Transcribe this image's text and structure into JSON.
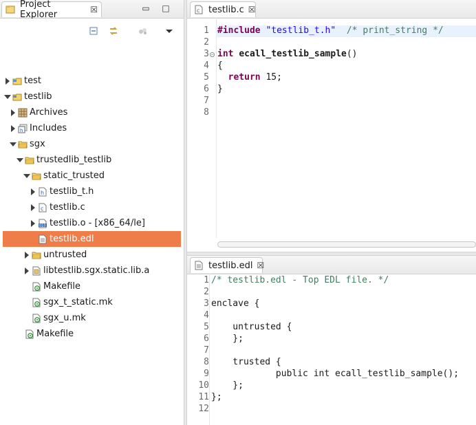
{
  "explorer": {
    "tab_label": "Project Explorer",
    "tab_close": "☒",
    "minimize": "▭",
    "maximize": "□",
    "toolbar_icons": [
      "collapse-all-icon",
      "link-editor-icon",
      "filter-icon",
      "view-menu-icon"
    ],
    "tree": [
      {
        "label": "test",
        "level": 0,
        "twisty": "collapsed",
        "icon": "project-icon"
      },
      {
        "label": "testlib",
        "level": 0,
        "twisty": "expanded",
        "icon": "project-icon"
      },
      {
        "label": "Archives",
        "level": 1,
        "twisty": "collapsed",
        "icon": "archives-icon"
      },
      {
        "label": "Includes",
        "level": 1,
        "twisty": "collapsed",
        "icon": "includes-icon"
      },
      {
        "label": "sgx",
        "level": 1,
        "twisty": "expanded",
        "icon": "folder-icon"
      },
      {
        "label": "trustedlib_testlib",
        "level": 2,
        "twisty": "expanded",
        "icon": "folder-icon"
      },
      {
        "label": "static_trusted",
        "level": 3,
        "twisty": "expanded",
        "icon": "folder-icon"
      },
      {
        "label": "testlib_t.h",
        "level": 4,
        "twisty": "collapsed",
        "icon": "header-file-icon"
      },
      {
        "label": "testlib.c",
        "level": 4,
        "twisty": "collapsed",
        "icon": "c-file-icon"
      },
      {
        "label": "testlib.o - [x86_64/le]",
        "level": 4,
        "twisty": "collapsed",
        "icon": "object-file-icon"
      },
      {
        "label": "testlib.edl",
        "level": 4,
        "twisty": "none",
        "icon": "text-file-icon",
        "selected": true
      },
      {
        "label": "untrusted",
        "level": 3,
        "twisty": "collapsed",
        "icon": "folder-icon"
      },
      {
        "label": "libtestlib.sgx.static.lib.a",
        "level": 3,
        "twisty": "collapsed",
        "icon": "archive-file-icon"
      },
      {
        "label": "Makefile",
        "level": 3,
        "twisty": "none",
        "icon": "makefile-icon"
      },
      {
        "label": "sgx_t_static.mk",
        "level": 3,
        "twisty": "none",
        "icon": "makefile-icon"
      },
      {
        "label": "sgx_u.mk",
        "level": 3,
        "twisty": "none",
        "icon": "makefile-icon"
      },
      {
        "label": "Makefile",
        "level": 2,
        "twisty": "none",
        "icon": "makefile-icon"
      }
    ]
  },
  "editor_c": {
    "tab_label": "testlib.c",
    "tab_close": "☒",
    "line_numbers": [
      "1",
      "2",
      "3",
      "4",
      "5",
      "6",
      "7",
      "8"
    ],
    "lines": [
      {
        "n": "1",
        "parts": [
          {
            "t": "#include",
            "c": "kw"
          },
          {
            "t": " ",
            "c": ""
          },
          {
            "t": "\"testlib_t.h\"",
            "c": "str"
          },
          {
            "t": "  /* print_string */",
            "c": "com"
          }
        ]
      },
      {
        "n": "2",
        "parts": []
      },
      {
        "n": "3",
        "parts": [
          {
            "t": "int",
            "c": "kw"
          },
          {
            "t": " ",
            "c": ""
          },
          {
            "t": "ecall_testlib_sample",
            "c": "fn"
          },
          {
            "t": "()",
            "c": ""
          }
        ]
      },
      {
        "n": "4",
        "parts": [
          {
            "t": "{",
            "c": ""
          }
        ]
      },
      {
        "n": "5",
        "parts": [
          {
            "t": "  ",
            "c": ""
          },
          {
            "t": "return",
            "c": "kw"
          },
          {
            "t": " 15;",
            "c": ""
          }
        ]
      },
      {
        "n": "6",
        "parts": [
          {
            "t": "}",
            "c": ""
          }
        ]
      },
      {
        "n": "7",
        "parts": []
      },
      {
        "n": "8",
        "parts": []
      }
    ]
  },
  "editor_edl": {
    "tab_label": "testlib.edl",
    "tab_close": "☒",
    "lines": [
      {
        "n": "1",
        "text": "/* testlib.edl - Top EDL file. */",
        "c": "com"
      },
      {
        "n": "2",
        "text": ""
      },
      {
        "n": "3",
        "text": "enclave {"
      },
      {
        "n": "4",
        "text": ""
      },
      {
        "n": "5",
        "text": "    untrusted {"
      },
      {
        "n": "6",
        "text": "    };"
      },
      {
        "n": "7",
        "text": ""
      },
      {
        "n": "8",
        "text": "    trusted {"
      },
      {
        "n": "9",
        "text": "            public int ecall_testlib_sample();"
      },
      {
        "n": "10",
        "text": "    };"
      },
      {
        "n": "11",
        "text": "};"
      },
      {
        "n": "12",
        "text": ""
      }
    ]
  },
  "colors": {
    "selection": "#ee7d4a",
    "keyword": "#7f0055",
    "string": "#2a00ff",
    "comment": "#3f7f5f",
    "current_line": "#e8f2fe"
  }
}
